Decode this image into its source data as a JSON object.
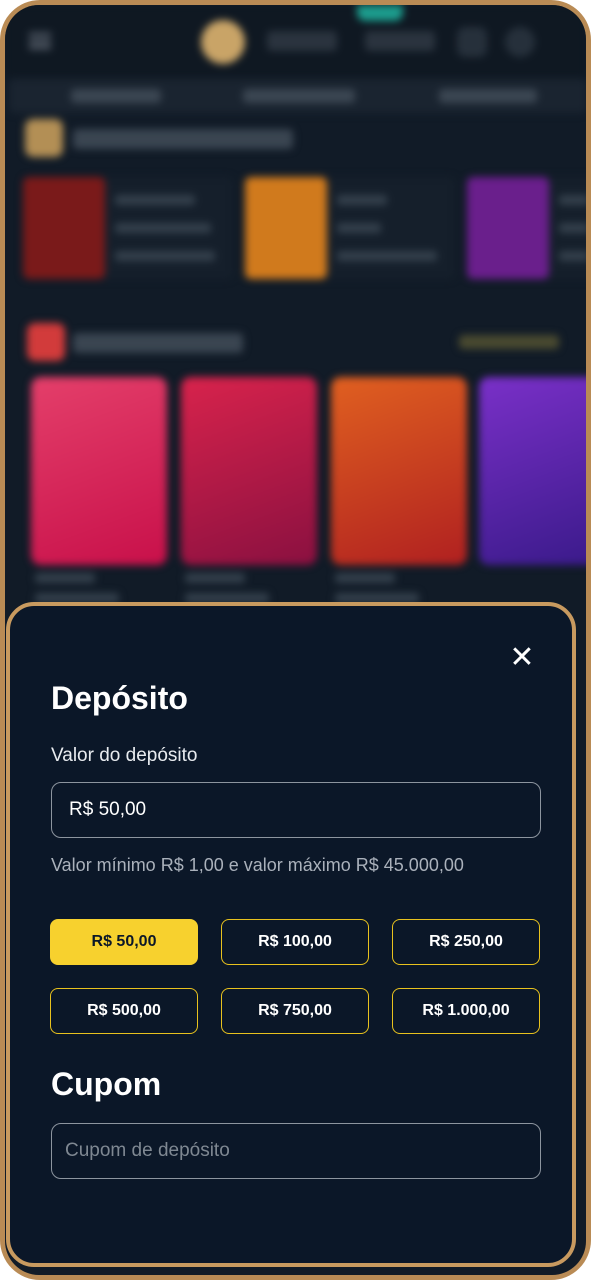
{
  "deposit": {
    "title": "Depósito",
    "amount_label": "Valor do depósito",
    "amount_value": "R$ 50,00",
    "limits_hint": "Valor mínimo R$ 1,00 e valor máximo R$ 45.000,00",
    "close_icon": "close-icon",
    "close_glyph": "✕",
    "amount_options": [
      {
        "label": "R$ 50,00",
        "selected": true
      },
      {
        "label": "R$ 100,00",
        "selected": false
      },
      {
        "label": "R$ 250,00",
        "selected": false
      },
      {
        "label": "R$ 500,00",
        "selected": false
      },
      {
        "label": "R$ 750,00",
        "selected": false
      },
      {
        "label": "R$ 1.000,00",
        "selected": false
      }
    ]
  },
  "coupon": {
    "title": "Cupom",
    "placeholder": "Cupom de depósito",
    "value": ""
  },
  "colors": {
    "modal_bg": "#0b1728",
    "accent_yellow": "#f7d12e",
    "frame_gold": "#c89a5f"
  }
}
